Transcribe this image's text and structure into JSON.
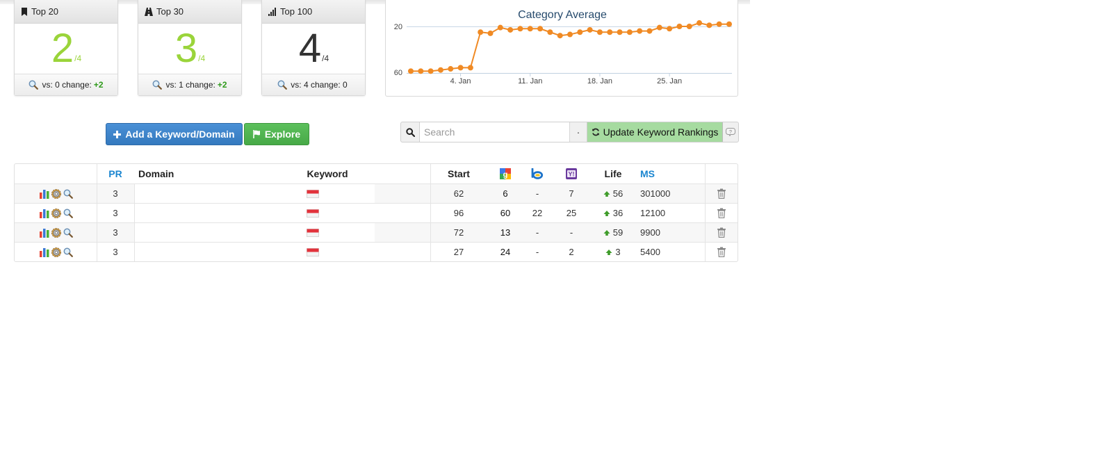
{
  "cards": [
    {
      "label": "Top 20",
      "icon": "bookmark-icon",
      "value": "2",
      "denominator": "/4",
      "footer_text": "vs: 0 change:",
      "change": "+2"
    },
    {
      "label": "Top 30",
      "icon": "road-icon",
      "value": "3",
      "denominator": "/4",
      "footer_text": "vs: 1 change:",
      "change": "+2"
    },
    {
      "label": "Top 100",
      "icon": "signal-icon",
      "value": "4",
      "denominator": "/4",
      "footer_text": "vs: 4 change: 0",
      "change": ""
    }
  ],
  "chart_data": {
    "type": "line",
    "title": "Category Average",
    "y_ticks": [
      20,
      60
    ],
    "y_range": [
      60,
      20
    ],
    "y_inverted": true,
    "x_ticks": [
      "4. Jan",
      "11. Jan",
      "18. Jan",
      "25. Jan"
    ],
    "x_tick_days": [
      4,
      11,
      18,
      25
    ],
    "x_start_day": -1,
    "color": "#f08a24",
    "series": [
      {
        "values": [
          59,
          59,
          59,
          58,
          57,
          56,
          56,
          25,
          26,
          21,
          23,
          22,
          22,
          22,
          25,
          28,
          27,
          25,
          23,
          25,
          25,
          25,
          25,
          24,
          24,
          21,
          22,
          20,
          20,
          17,
          19,
          18,
          18
        ]
      }
    ]
  },
  "actions": {
    "add_label": "Add a Keyword/Domain",
    "explore_label": "Explore"
  },
  "search": {
    "placeholder": "Search",
    "dot": "·",
    "update_label": "Update Keyword Rankings"
  },
  "table": {
    "headers": {
      "pr": "PR",
      "domain": "Domain",
      "keyword": "Keyword",
      "start": "Start",
      "life": "Life",
      "ms": "MS"
    },
    "rows": [
      {
        "pr": "3",
        "start": "62",
        "google": "6",
        "bing": "-",
        "yahoo": "7",
        "life": "56",
        "ms": "301000"
      },
      {
        "pr": "3",
        "start": "96",
        "google": "60",
        "bing": "22",
        "yahoo": "25",
        "life": "36",
        "ms": "12100"
      },
      {
        "pr": "3",
        "start": "72",
        "google": "13",
        "bing": "-",
        "yahoo": "-",
        "life": "59",
        "ms": "9900"
      },
      {
        "pr": "3",
        "start": "27",
        "google": "24",
        "bing": "-",
        "yahoo": "2",
        "life": "3",
        "ms": "5400"
      }
    ]
  },
  "colors": {
    "accent_green": "#9ad43a",
    "change_green": "#2e9a1a",
    "blue_button": "#3f86cb",
    "green_button": "#52b552",
    "update_bg": "#a6dba0",
    "header_blue": "#1b86d0",
    "chart_line": "#f08a24"
  }
}
